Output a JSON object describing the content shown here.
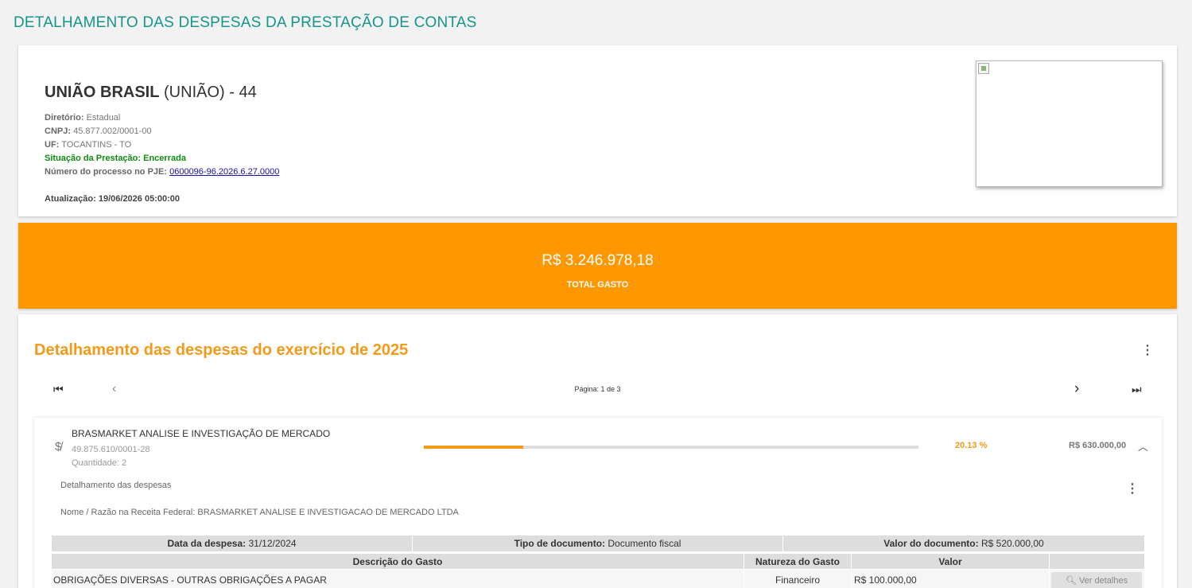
{
  "page": {
    "title": "DETALHAMENTO DAS DESPESAS DA PRESTAÇÃO DE CONTAS"
  },
  "header": {
    "party_name": "UNIÃO BRASIL",
    "party_abbrev": "(UNIÃO) - 44",
    "directorate_label": "Diretório:",
    "directorate_value": "Estadual",
    "cnpj_label": "CNPJ:",
    "cnpj_value": "45.877.002/0001-00",
    "uf_label": "UF:",
    "uf_value": "TOCANTINS - TO",
    "status_label": "Situação da Prestação:",
    "status_value": "Encerrada",
    "process_label": "Número do processo no PJE:",
    "process_value": "0600096-96.2026.6.27.0000",
    "updated_label": "Atualização:",
    "updated_value": "19/06/2026 05:00:00",
    "status_color": "#118a11"
  },
  "total": {
    "value": "R$ 3.246.978,18",
    "label": "TOTAL GASTO",
    "color": "#ff9800"
  },
  "details": {
    "title": "Detalhamento das despesas do exercício de 2025",
    "pagination_text": "Página: 1 de 3",
    "icons": [
      "first-page-icon",
      "prev-page-icon",
      "next-page-icon",
      "last-page-icon",
      "more-vert-icon"
    ]
  },
  "supplier": {
    "name": "BRASMARKET ANALISE E INVESTIGAÇÃO DE MERCADO",
    "cnpj": "49.875.610/0001-28",
    "quantity": "Quantidade: 2",
    "percent_text": "20.13 %",
    "percent_fill": 0.2013,
    "value": "R$ 630.000,00",
    "details_label": "Detalhamento das despesas",
    "rf_name": "Nome / Razão na Receita Federal: BRASMARKET ANALISE E INVESTIGACAO DE MERCADO LTDA",
    "icon": "money-off-icon",
    "accent": "#f39a1a"
  },
  "expense": {
    "date_label": "Data da despesa:",
    "date_value": "31/12/2024",
    "doc_type_label": "Tipo de documento:",
    "doc_type_value": "Documento fiscal",
    "doc_value_label": "Valor do documento:",
    "doc_value_value": "R$ 520.000,00",
    "columns": [
      "Descrição do Gasto",
      "Natureza do Gasto",
      "Valor",
      ""
    ],
    "rows": [
      {
        "description": "OBRIGAÇÕES DIVERSAS - OUTRAS OBRIGAÇÕES A PAGAR",
        "nature": "Financeiro",
        "value": "R$ 100.000,00",
        "action": "Ver detalhes"
      }
    ]
  }
}
